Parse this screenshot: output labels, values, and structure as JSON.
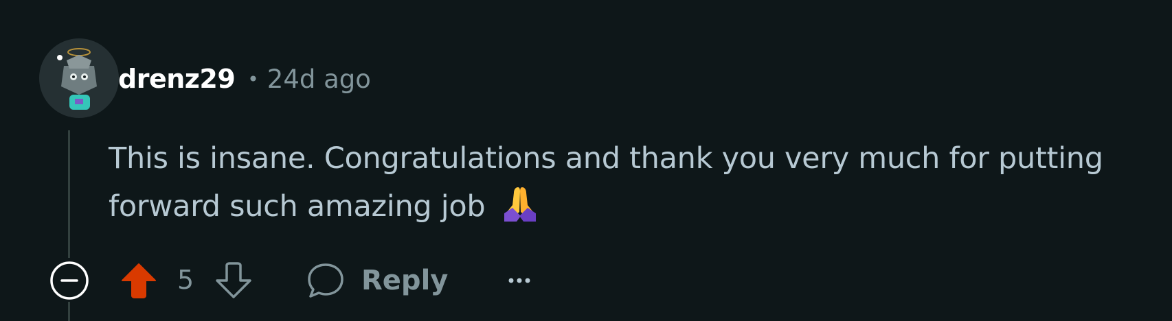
{
  "comment": {
    "username": "drenz29",
    "separator": "•",
    "timestamp": "24d ago",
    "text": "This is insane. Congratulations and thank you very much for putting forward such amazing job",
    "emoji": "folded-hands"
  },
  "actions": {
    "vote_count": "5",
    "reply_label": "Reply"
  },
  "icons": {
    "collapse": "minus-circle-icon",
    "upvote": "upvote-arrow-icon",
    "downvote": "downvote-arrow-icon",
    "reply": "speech-bubble-icon",
    "more": "ellipsis-icon"
  },
  "colors": {
    "background": "#0e1719",
    "upvote_active": "#d93a00",
    "muted": "#82959b",
    "text": "#b7c9d3"
  }
}
